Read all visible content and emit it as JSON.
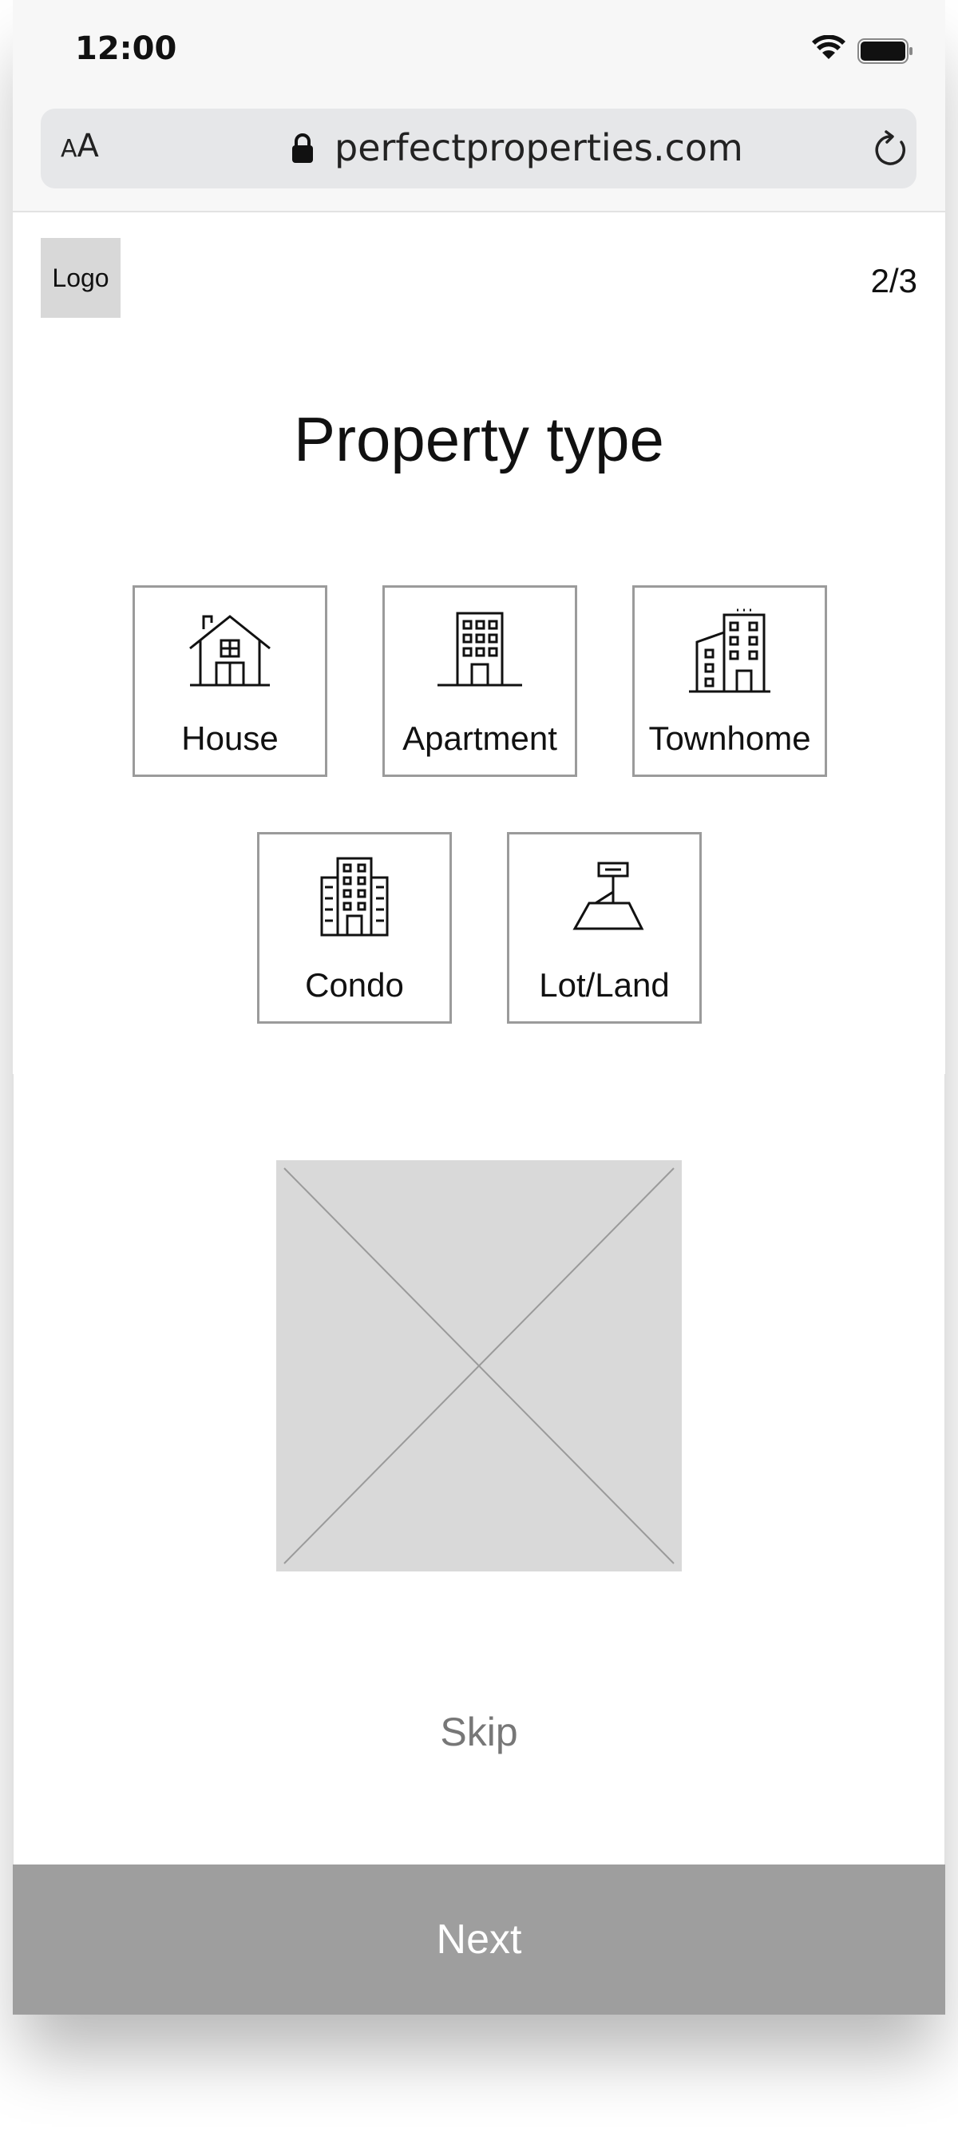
{
  "status_bar": {
    "time": "12:00",
    "icons": [
      "wifi-icon",
      "battery-icon"
    ]
  },
  "browser": {
    "text_size_label_small": "A",
    "text_size_label_large": "A",
    "url": "perfectproperties.com",
    "icons": [
      "lock-icon",
      "reload-icon"
    ]
  },
  "header": {
    "logo_text": "Logo",
    "step": "2/3"
  },
  "main": {
    "title": "Property type",
    "options": [
      {
        "label": "House",
        "icon": "house-icon"
      },
      {
        "label": "Apartment",
        "icon": "apartment-icon"
      },
      {
        "label": "Townhome",
        "icon": "townhome-icon"
      },
      {
        "label": "Condo",
        "icon": "condo-icon"
      },
      {
        "label": "Lot/Land",
        "icon": "lot-land-icon"
      }
    ],
    "skip_label": "Skip",
    "next_label": "Next"
  },
  "colors": {
    "next_button_bg": "#9e9e9e",
    "tile_border": "#9b9b9b",
    "placeholder_bg": "#d9d9d9"
  }
}
